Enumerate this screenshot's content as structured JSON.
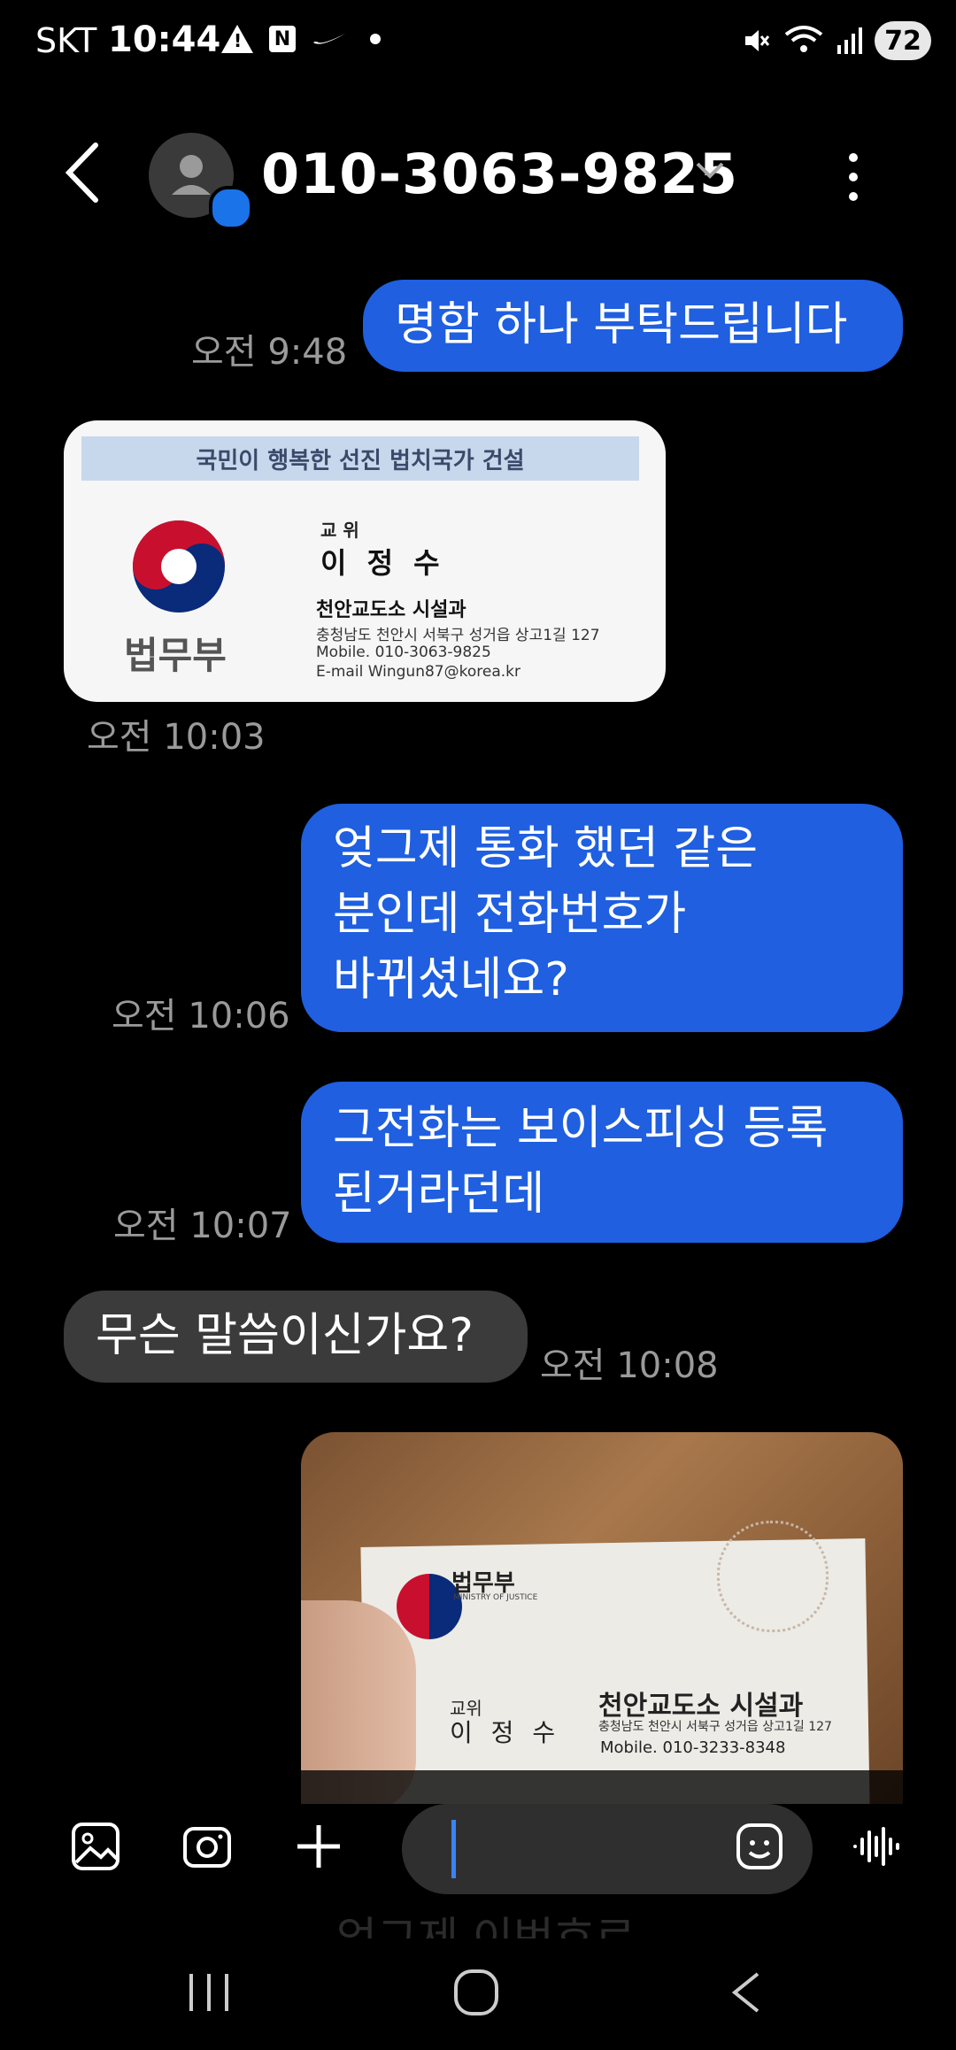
{
  "status_bar": {
    "carrier": "SKT",
    "time": "10:44",
    "battery": "72"
  },
  "header": {
    "contact": "010-3063-9825"
  },
  "messages": [
    {
      "dir": "out",
      "text": "명함 하나 부탁드립니다",
      "time": "오전 9:48"
    },
    {
      "dir": "in",
      "kind": "image",
      "time": "오전 10:03"
    },
    {
      "dir": "out",
      "text_lines": [
        "엊그제 통화 했던 같은",
        "분인데 전화번호가",
        "바뀌셨네요?"
      ],
      "time": "오전 10:06"
    },
    {
      "dir": "out",
      "text_lines": [
        "그전화는 보이스피싱 등록",
        "된거라던데"
      ],
      "time": "오전 10:07"
    },
    {
      "dir": "in",
      "text": "무슨 말씀이신가요?",
      "time": "오전 10:08"
    },
    {
      "dir": "out",
      "kind": "image"
    }
  ],
  "card1": {
    "banner": "국민이 행복한 선진 법치국가 건설",
    "org": "법무부",
    "rank": "교 위",
    "name": "이 정 수",
    "dept": "천안교도소 시설과",
    "address": "충청남도 천안시 서북구 성거읍 상고1길 127",
    "mobile": "Mobile.  010-3063-9825",
    "email": "E-mail   Wingun87@korea.kr"
  },
  "card2": {
    "org": "법무부",
    "org_en": "MINISTRY OF JUSTICE",
    "rank": "교위",
    "name": "이 정 수",
    "dept": "천안교도소 시설과",
    "address": "충청남도 천안시 서북구 성거읍 상고1길 127",
    "mobile": "Mobile. 010-3233-8348"
  },
  "composer": {
    "placeholder": ""
  },
  "hidden_behind": "엊그제 이번호로"
}
